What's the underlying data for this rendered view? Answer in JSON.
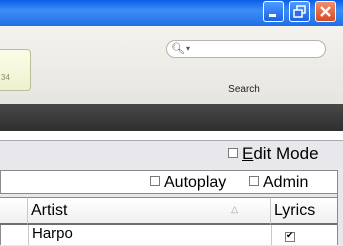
{
  "toolbar": {
    "lcd_text": "34",
    "search_label": "Search"
  },
  "options": {
    "edit_mode_label": "Edit Mode",
    "autoplay_label": "Autoplay",
    "admin_label": "Admin"
  },
  "table": {
    "columns": [
      "Artist",
      "Lyrics"
    ],
    "rows": [
      {
        "artist": "Harpo",
        "lyrics": true
      }
    ]
  },
  "colors": {
    "titlebar": "#1f6fe6",
    "close": "#d84a22",
    "dark_bar": "#3a3a3a"
  }
}
